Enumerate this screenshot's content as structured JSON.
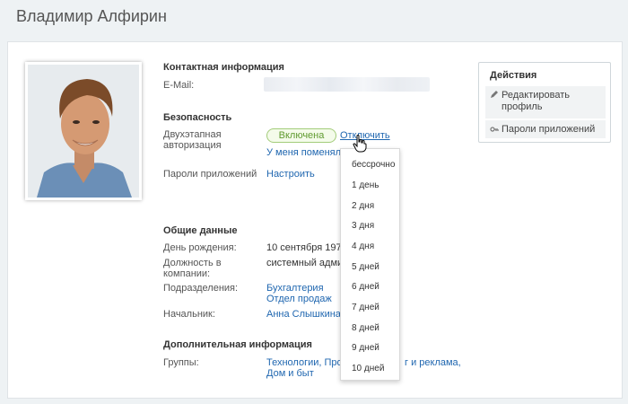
{
  "page": {
    "title": "Владимир Алфирин"
  },
  "contact": {
    "title": "Контактная информация",
    "email_label": "E-Mail:"
  },
  "security": {
    "title": "Безопасность",
    "two_factor_label": "Двухэтапная авторизация",
    "two_factor_label_line1": "Двухэтапная",
    "two_factor_label_line2": "авторизация",
    "status_badge": "Включена",
    "disable_link": "Отключить",
    "changed_link": "У меня поменяло",
    "app_passwords_label": "Пароли приложений",
    "configure_link": "Настроить"
  },
  "general": {
    "title": "Общие данные",
    "birthday_label": "День рождения:",
    "birthday_value": "10 сентября 197",
    "position_label_line1": "Должность в",
    "position_label_line2": "компании:",
    "position_value": "системный адми",
    "departments_label": "Подразделения:",
    "department_1": "Бухгалтерия",
    "department_2": "Отдел продаж",
    "manager_label": "Начальник:",
    "manager_value": "Анна Слышкина"
  },
  "additional": {
    "title": "Дополнительная информация",
    "groups_label": "Группы:",
    "groups_line1_a": "Технологии, Прод",
    "groups_line1_b": "г и реклама,",
    "groups_line2": "Дом и быт"
  },
  "dropdown": {
    "items": [
      "бессрочно",
      "1 день",
      "2 дня",
      "3 дня",
      "4 дня",
      "5 дней",
      "6 дней",
      "7 дней",
      "8 дней",
      "9 дней",
      "10 дней"
    ]
  },
  "actions": {
    "title": "Действия",
    "edit_line1": "Редактировать",
    "edit_line2": "профиль",
    "app_passwords": "Пароли приложений"
  },
  "colors": {
    "link": "#2067b0",
    "badge_border": "#a3cc7a",
    "badge_text": "#5f9a2f",
    "background": "#eef2f4"
  }
}
